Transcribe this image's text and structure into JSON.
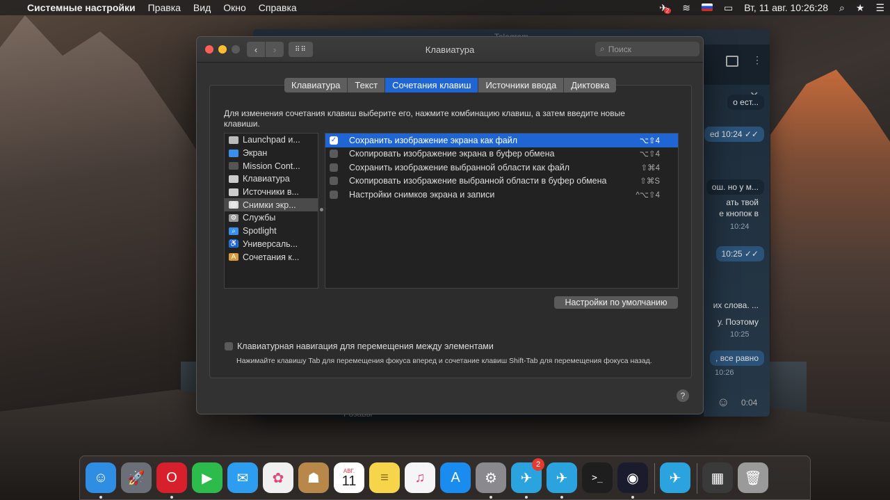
{
  "menubar": {
    "app_name": "Системные настройки",
    "menus": [
      "Правка",
      "Вид",
      "Окно",
      "Справка"
    ],
    "notification_badge": "2",
    "datetime": "Вт, 11 авг.  10:26:28"
  },
  "telegram_bg": {
    "title": "Telegram",
    "messages": [
      {
        "text": "о ест...",
        "time": ""
      },
      {
        "text": "ed 10:24",
        "time": ""
      },
      {
        "text": "ош. но у м...",
        "time": ""
      },
      {
        "text": "ать твой",
        "time": ""
      },
      {
        "text": "е кнопок в",
        "time": "10:24"
      },
      {
        "text": "",
        "time": "10:25"
      },
      {
        "text": "их слова. ...",
        "time": ""
      },
      {
        "text": "у. Поэтому",
        "time": "10:25"
      },
      {
        "text": ", все равно",
        "time": "10:26"
      }
    ],
    "voice_time": "0:04",
    "bottom_text": "Розавы"
  },
  "window": {
    "title": "Клавиатура",
    "search_placeholder": "Поиск",
    "tabs": [
      "Клавиатура",
      "Текст",
      "Сочетания клавиш",
      "Источники ввода",
      "Диктовка"
    ],
    "active_tab": "Сочетания клавиш",
    "hint": "Для изменения сочетания клавиш выберите его, нажмите комбинацию клавиш, а затем введите новые клавиши.",
    "categories": [
      {
        "label": "Launchpad и...",
        "icon": "launchpad-icon",
        "color": "#bbbbbb"
      },
      {
        "label": "Экран",
        "icon": "display-icon",
        "color": "#3a8fe6"
      },
      {
        "label": "Mission Cont...",
        "icon": "mission-control-icon",
        "color": "#555555"
      },
      {
        "label": "Клавиатура",
        "icon": "keyboard-icon",
        "color": "#cccccc"
      },
      {
        "label": "Источники в...",
        "icon": "input-sources-icon",
        "color": "#cccccc"
      },
      {
        "label": "Снимки экр...",
        "icon": "screenshot-icon",
        "color": "#dddddd"
      },
      {
        "label": "Службы",
        "icon": "services-gear-icon",
        "color": "#999999"
      },
      {
        "label": "Spotlight",
        "icon": "spotlight-icon",
        "color": "#3a8fe6"
      },
      {
        "label": "Универсаль...",
        "icon": "accessibility-icon",
        "color": "#1e7be0"
      },
      {
        "label": "Сочетания к...",
        "icon": "app-shortcuts-icon",
        "color": "#d89a3a"
      }
    ],
    "selected_category": "Снимки экр...",
    "shortcuts": [
      {
        "label": "Сохранить изображение экрана как файл",
        "keys": "⌥⇧4",
        "checked": true
      },
      {
        "label": "Скопировать изображение экрана в буфер обмена",
        "keys": "⌥⇧4",
        "checked": false
      },
      {
        "label": "Сохранить изображение выбранной области как файл",
        "keys": "⇧⌘4",
        "checked": false
      },
      {
        "label": "Скопировать изображение выбранной области в буфер обмена",
        "keys": "⇧⌘S",
        "checked": false
      },
      {
        "label": "Настройки снимков экрана и записи",
        "keys": "^⌥⇧4",
        "checked": false
      }
    ],
    "defaults_button": "Настройки по умолчанию",
    "keyboard_nav_label": "Клавиатурная навигация для перемещения между элементами",
    "keyboard_nav_note": "Нажимайте клавишу Tab для перемещения фокуса вперед и сочетание клавиш Shift-Tab для перемещения фокуса назад.",
    "help": "?"
  },
  "dock": {
    "apps": [
      {
        "name": "Finder",
        "icon": "finder-icon",
        "color": "#2f8de4",
        "running": true
      },
      {
        "name": "Launchpad",
        "icon": "launchpad-rocket-icon",
        "color": "#6b6f78",
        "running": false
      },
      {
        "name": "Opera",
        "icon": "opera-icon",
        "color": "#d8202c",
        "running": true
      },
      {
        "name": "FaceTime",
        "icon": "facetime-icon",
        "color": "#2dbb4c",
        "running": false
      },
      {
        "name": "Messages",
        "icon": "messages-icon",
        "color": "#2d9df0",
        "running": false
      },
      {
        "name": "Photos",
        "icon": "photos-icon",
        "color": "#f0f0f0",
        "running": false
      },
      {
        "name": "Contacts",
        "icon": "contacts-icon",
        "color": "#b8884a",
        "running": false
      },
      {
        "name": "Calendar",
        "icon": "calendar-icon",
        "color": "#ffffff",
        "running": false,
        "month": "АВГ.",
        "day": "11"
      },
      {
        "name": "Notes",
        "icon": "notes-icon",
        "color": "#f7d54a",
        "running": false
      },
      {
        "name": "Music",
        "icon": "music-icon",
        "color": "#f5f5f7",
        "running": false
      },
      {
        "name": "App Store",
        "icon": "app-store-icon",
        "color": "#1a8cf0",
        "running": false
      },
      {
        "name": "System Preferences",
        "icon": "system-preferences-icon",
        "color": "#8a8a8e",
        "running": true
      },
      {
        "name": "Telegram",
        "icon": "telegram-icon",
        "color": "#2aa3df",
        "running": true,
        "badge": "2"
      },
      {
        "name": "Telegram Lite",
        "icon": "telegram-icon",
        "color": "#2aa3df",
        "running": true
      },
      {
        "name": "Terminal",
        "icon": "terminal-icon",
        "color": "#1e1e1e",
        "running": false
      },
      {
        "name": "Siri",
        "icon": "siri-icon",
        "color": "#1b1b2e",
        "running": true
      },
      {
        "name": "Telegram",
        "icon": "telegram-icon",
        "color": "#2aa3df",
        "running": false
      },
      {
        "name": "Downloads",
        "icon": "downloads-stack-icon",
        "color": "#3a3a3a",
        "running": false
      },
      {
        "name": "Trash",
        "icon": "trash-icon",
        "color": "#9a9a9a",
        "running": false
      }
    ]
  }
}
